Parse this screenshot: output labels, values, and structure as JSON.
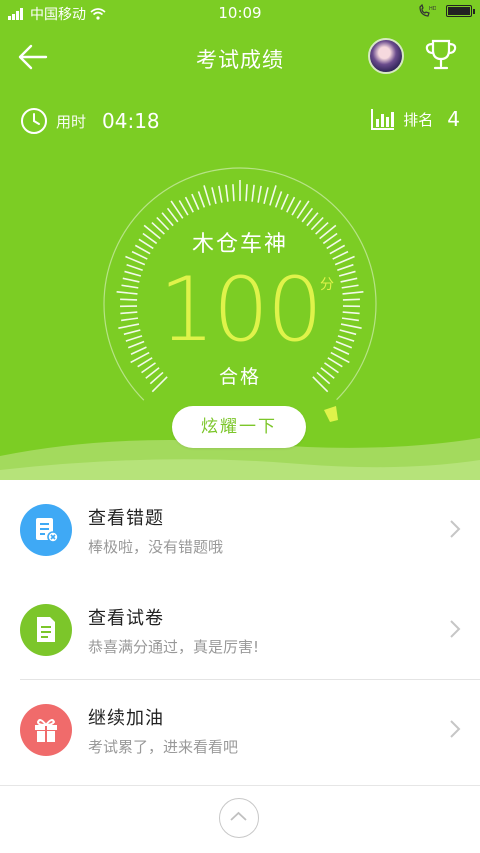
{
  "status_bar": {
    "carrier": "中国移动",
    "time": "10:09"
  },
  "header": {
    "title": "考试成绩"
  },
  "stats": {
    "time_label": "用时",
    "time_value": "04:18",
    "rank_label": "排名",
    "rank_value": "4"
  },
  "result": {
    "name": "木仓车神",
    "score": "100",
    "score_unit": "分",
    "status": "合格",
    "show_off_label": "炫耀一下"
  },
  "list": {
    "items": [
      {
        "title": "查看错题",
        "subtitle": "棒极啦，没有错题哦",
        "icon": "wrong-questions-icon",
        "color": "#3fa9f5"
      },
      {
        "title": "查看试卷",
        "subtitle": "恭喜满分通过，真是厉害!",
        "icon": "exam-paper-icon",
        "color": "#7cc62a"
      },
      {
        "title": "继续加油",
        "subtitle": "考试累了，进来看看吧",
        "icon": "gift-icon",
        "color": "#f06b6b"
      }
    ]
  },
  "colors": {
    "primary": "#7ccd24",
    "score": "#dff34a"
  }
}
